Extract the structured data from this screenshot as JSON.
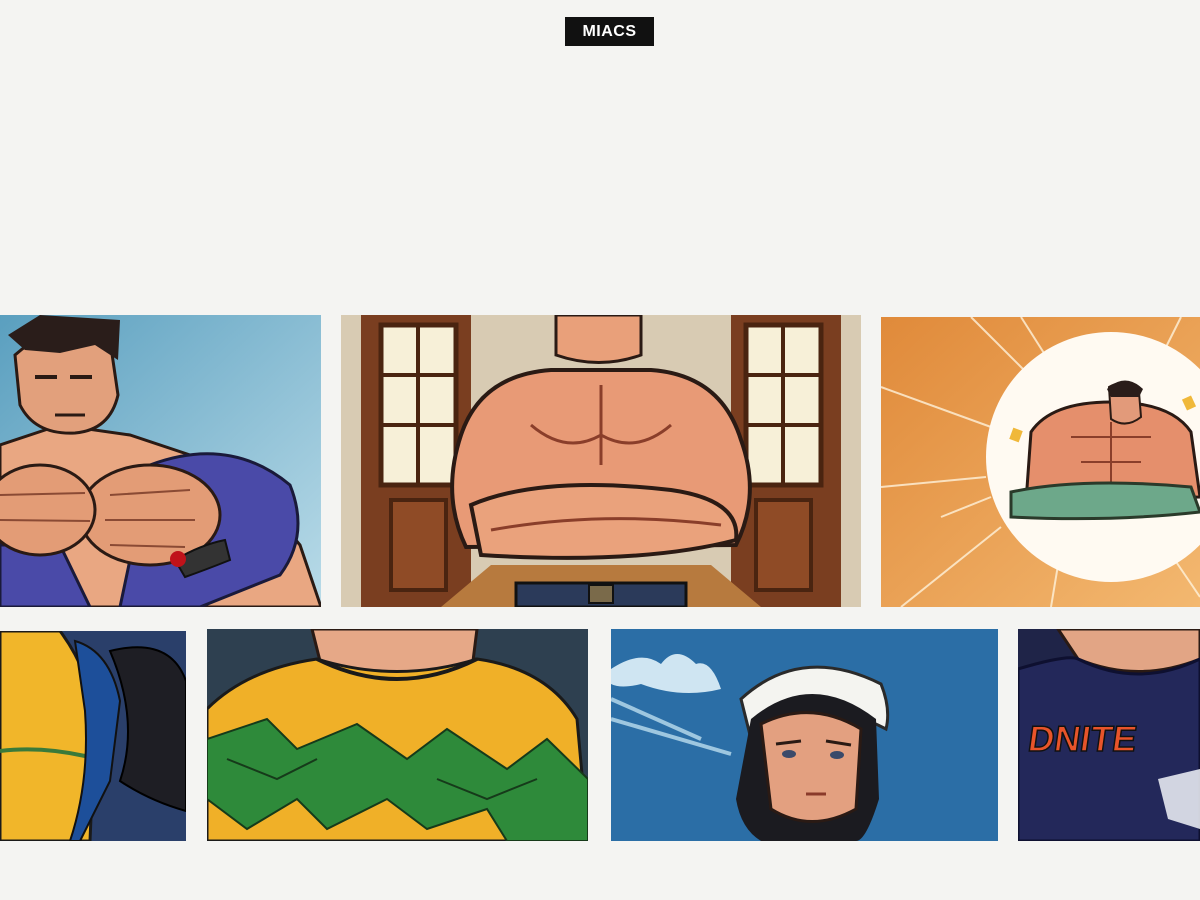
{
  "header": {
    "logo_text": "MIACS"
  },
  "gallery": {
    "tiles": [
      {
        "label": "fists-together-blue-shirt",
        "bg": "#7fb6cf"
      },
      {
        "label": "arms-crossed-doorway",
        "bg": "#d9ccb4"
      },
      {
        "label": "sunburst-muscle-pose",
        "bg": "#e79a4c"
      },
      {
        "label": "yellow-shirt-torso",
        "bg": "#223c66"
      },
      {
        "label": "green-yellow-shirt-torso",
        "bg": "#2f4253"
      },
      {
        "label": "sailor-cap-portrait",
        "bg": "#2b6da3"
      },
      {
        "label": "navy-shirt-torso",
        "bg": "#1e2247"
      }
    ]
  },
  "artwork_text": {
    "shirt_print": "DNITE"
  },
  "colors": {
    "page_bg": "#f4f4f2",
    "logo_bg": "#111111",
    "logo_fg": "#ffffff"
  }
}
